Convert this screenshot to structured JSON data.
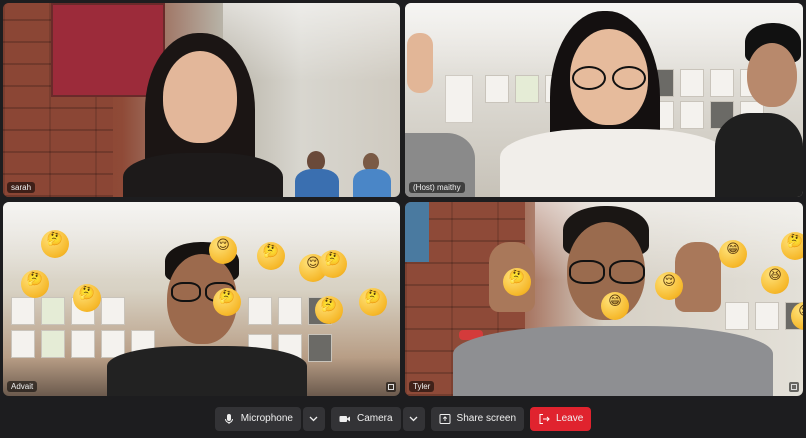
{
  "participants": [
    {
      "id": "sarah",
      "name": "sarah"
    },
    {
      "id": "maithy",
      "name": "(Host) maithy"
    },
    {
      "id": "advait",
      "name": "Advait"
    },
    {
      "id": "tyler",
      "name": "Tyler"
    }
  ],
  "controls": {
    "microphone": "Microphone",
    "camera": "Camera",
    "share": "Share screen",
    "leave": "Leave"
  },
  "reactions": {
    "thinking": "thinking-face",
    "grin": "grinning-face",
    "relieved": "relieved-face",
    "squint": "squinting-face"
  },
  "colors": {
    "leave": "#e0232e",
    "button": "#333336",
    "background": "#1d1d1f"
  }
}
